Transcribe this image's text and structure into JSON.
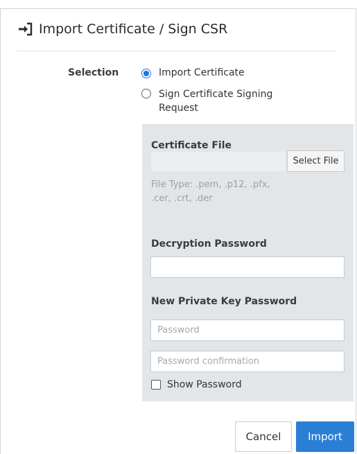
{
  "dialog": {
    "title": "Import Certificate / Sign CSR",
    "title_icon": "sign-in-icon"
  },
  "selection": {
    "label": "Selection",
    "options": [
      {
        "label": "Import Certificate",
        "selected": true
      },
      {
        "label": "Sign Certificate Signing Request",
        "selected": false
      }
    ]
  },
  "certificate_file": {
    "label": "Certificate File",
    "value": "",
    "select_button": "Select File",
    "help": "File Type: .pem, .p12, .pfx, .cer, .crt, .der"
  },
  "decryption_password": {
    "label": "Decryption Password",
    "value": ""
  },
  "new_private_key": {
    "label": "New Private Key Password",
    "password_placeholder": "Password",
    "confirmation_placeholder": "Password confirmation",
    "show_password_label": "Show Password",
    "show_password_checked": false
  },
  "footer": {
    "cancel_label": "Cancel",
    "import_label": "Import"
  },
  "colors": {
    "accent": "#2a7fd4",
    "panel_bg": "#e3e6e8",
    "radio_selected": "#1a73e8"
  }
}
